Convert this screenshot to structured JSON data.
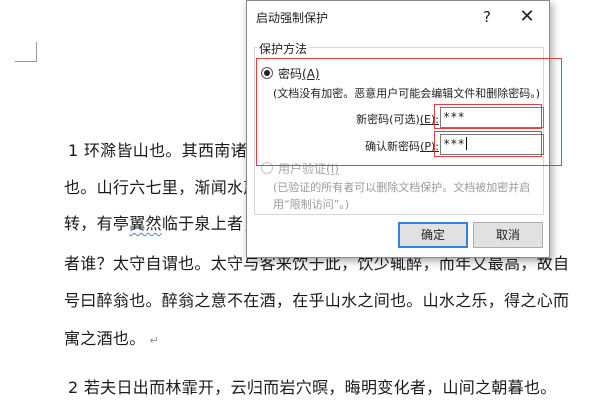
{
  "document": {
    "lines": [
      "1 环滁皆山也。其西南诸峰",
      "也。山行六七里，渐闻水声潺潺",
      "转，有亭翼然临于泉上者，醉翁",
      "者谁？太守自谓也。太守与客来饮于此，饮少辄醉，而年又最高，故自",
      "号曰醉翁也。醉翁之意不在酒，在乎山水之间也。山水之乐，得之心而",
      "寓之酒也。",
      "2 若夫日出而林霏开，云归而岩穴暝，晦明变化者，山间之朝暮也。"
    ],
    "paragraph_mark": "↵"
  },
  "dialog": {
    "title": "启动强制保护",
    "help_label": "?",
    "close_label": "✕",
    "group_label": "保护方法",
    "password_option": {
      "label": "密码",
      "hotkey": "(A)",
      "description": "(文档没有加密。恶意用户可能会编辑文件和删除密码。)",
      "checked": true
    },
    "new_password": {
      "label": "新密码(可选)",
      "hotkey": "(E):",
      "value": "***"
    },
    "confirm_password": {
      "label": "确认新密码",
      "hotkey": "(P):",
      "value": "***"
    },
    "user_auth_option": {
      "label": "用户验证",
      "hotkey": "(I)",
      "description": "(已验证的所有者可以删除文档保护。文档被加密并启用“限制访问”。)",
      "enabled": false
    },
    "ok_label": "确定",
    "cancel_label": "取消"
  },
  "colors": {
    "highlight": "#e04040",
    "ok_border": "#3c7fd6",
    "spellcheck_underline": "#5b7fc7"
  }
}
